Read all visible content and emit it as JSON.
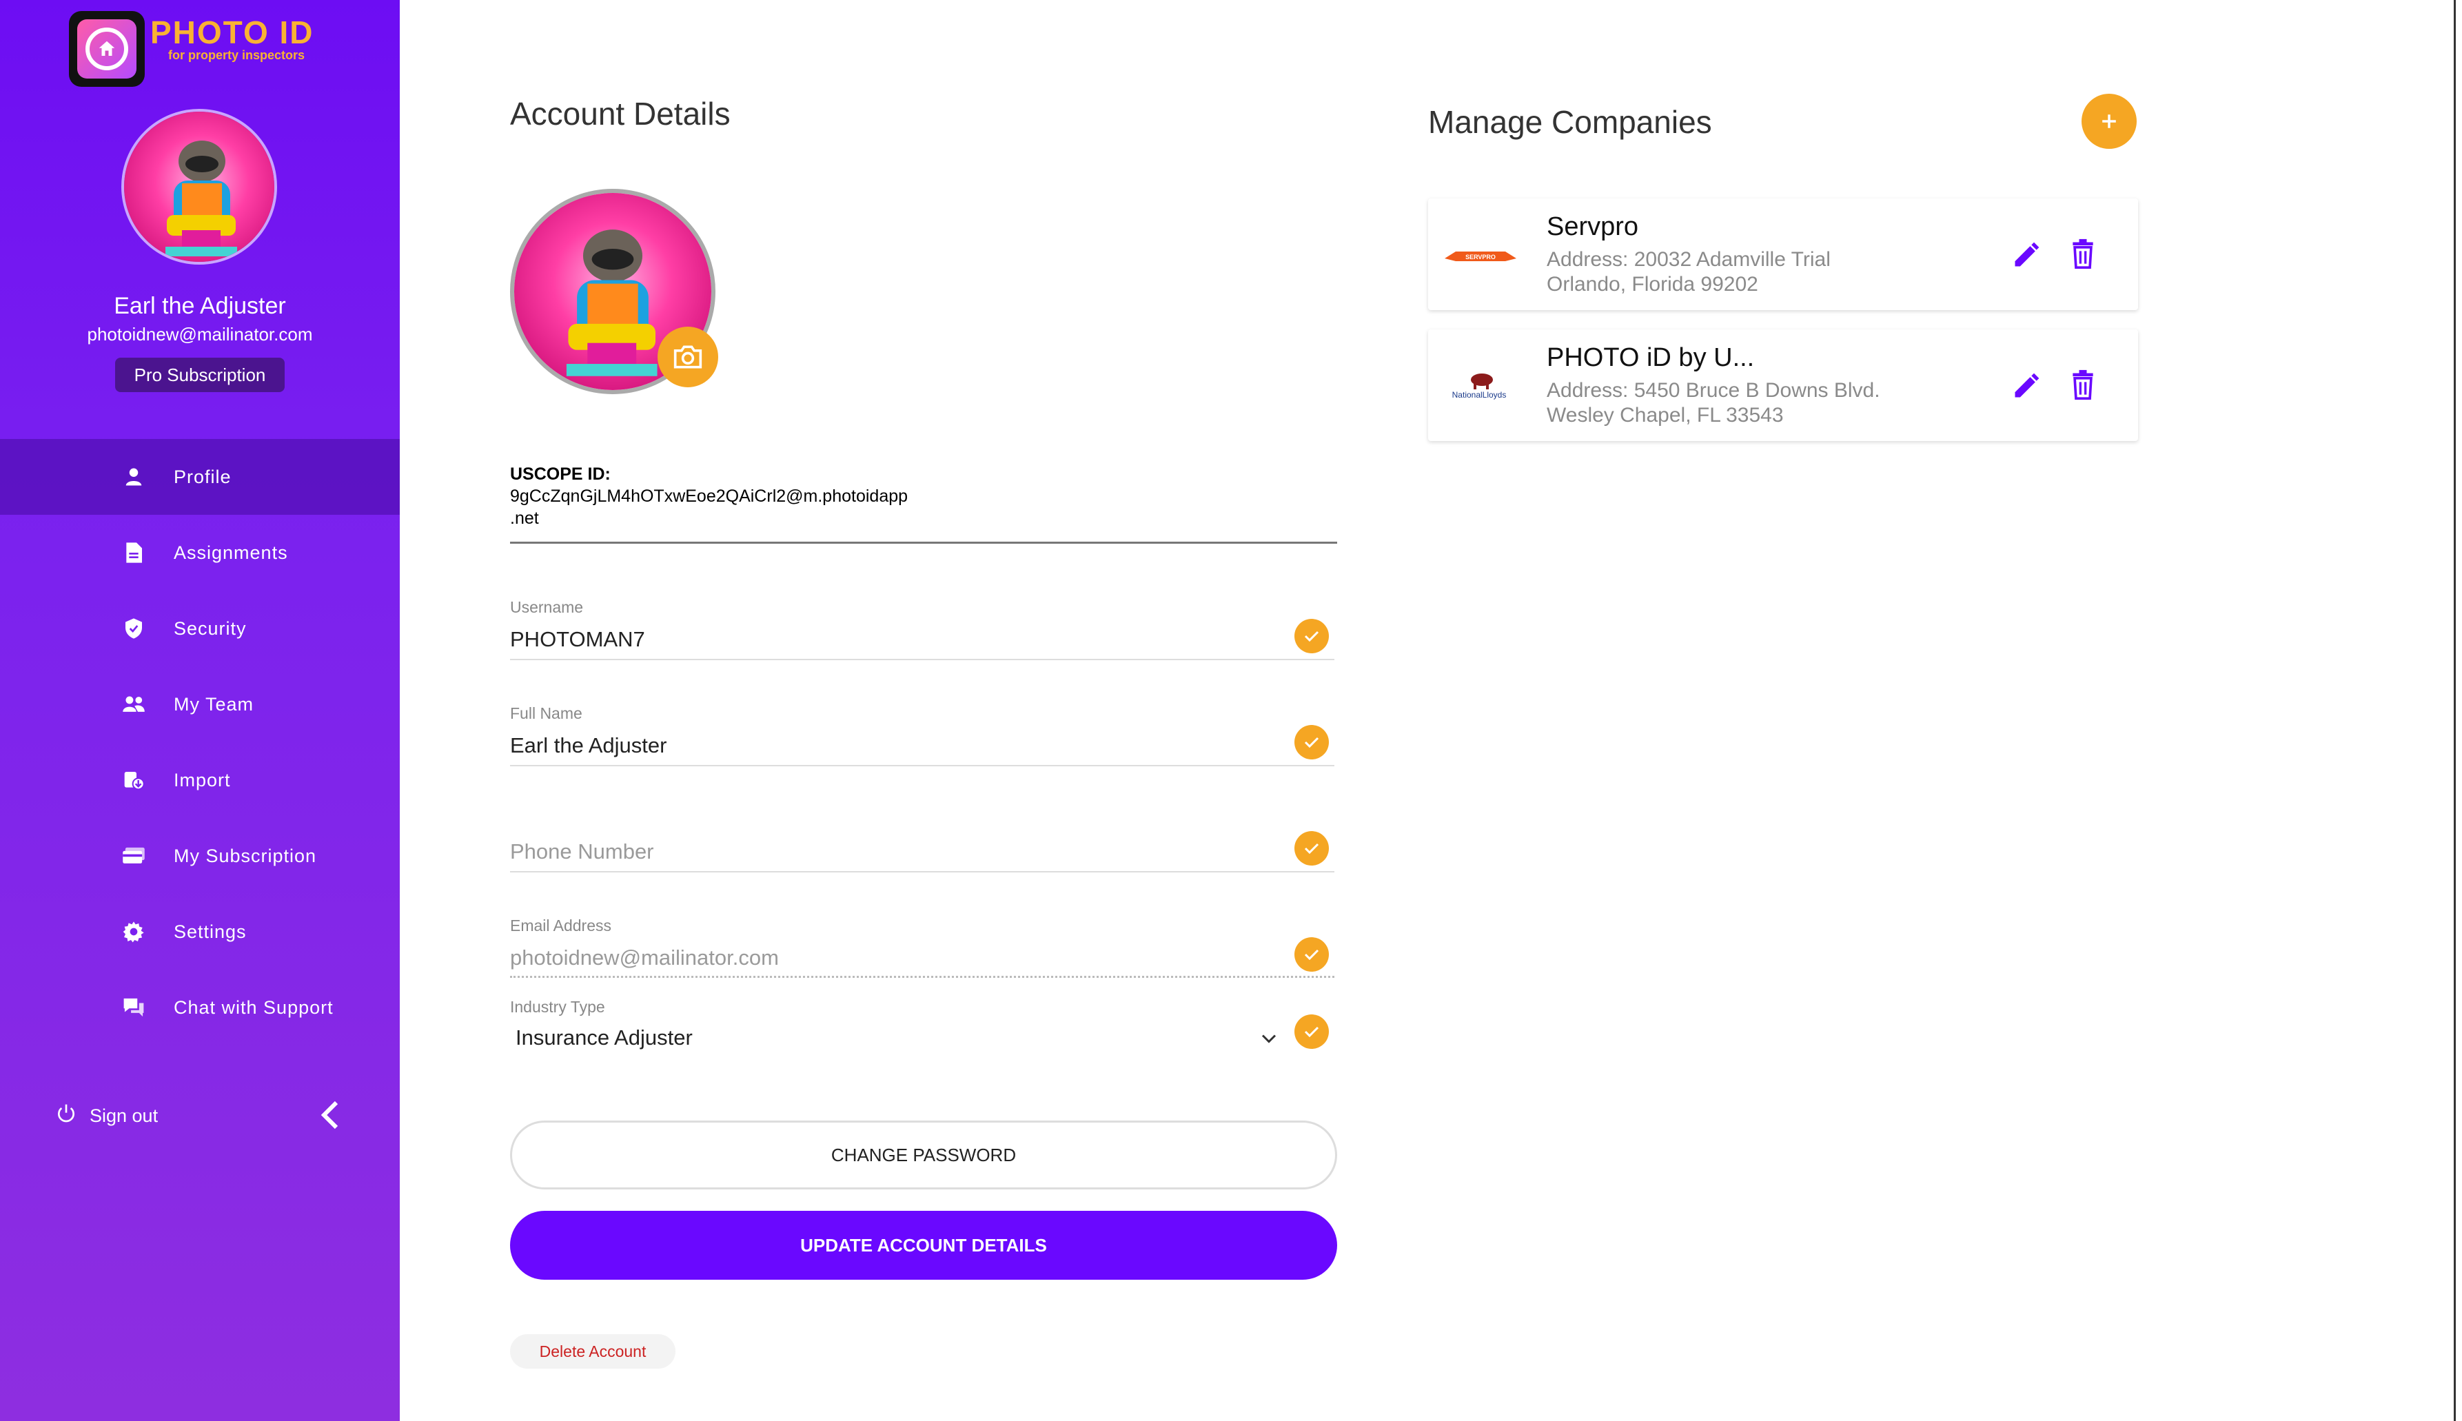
{
  "brand": {
    "name": "PHOTO ID",
    "tagline": "for property inspectors"
  },
  "user": {
    "name": "Earl the Adjuster",
    "email": "photoidnew@mailinator.com",
    "subscription": "Pro Subscription"
  },
  "nav": [
    {
      "label": "Profile",
      "icon": "person-icon",
      "active": true
    },
    {
      "label": "Assignments",
      "icon": "document-icon"
    },
    {
      "label": "Security",
      "icon": "shield-icon"
    },
    {
      "label": "My Team",
      "icon": "team-icon"
    },
    {
      "label": "Import",
      "icon": "import-icon"
    },
    {
      "label": "My Subscription",
      "icon": "card-icon"
    },
    {
      "label": "Settings",
      "icon": "gear-icon"
    },
    {
      "label": "Chat with Support",
      "icon": "chat-icon"
    }
  ],
  "signout": {
    "label": "Sign out"
  },
  "account": {
    "title": "Account Details",
    "uscope_label": "USCOPE ID:",
    "uscope_value": "9gCcZqnGjLM4hOTxwEoe2QAiCrl2@m.photoidapp\n.net",
    "username": {
      "label": "Username",
      "value": "PHOTOMAN7"
    },
    "fullname": {
      "label": "Full Name",
      "value": "Earl the Adjuster"
    },
    "phone": {
      "placeholder": "Phone Number"
    },
    "email": {
      "label": "Email Address",
      "value": "photoidnew@mailinator.com"
    },
    "industry": {
      "label": "Industry Type",
      "value": "Insurance Adjuster"
    },
    "change_password": "CHANGE PASSWORD",
    "update": "UPDATE ACCOUNT DETAILS",
    "delete": "Delete Account"
  },
  "companies": {
    "title": "Manage Companies",
    "items": [
      {
        "name": "Servpro",
        "address1": "Address: 20032 Adamville Trial",
        "address2": "Orlando, Florida 99202",
        "logo_text": "SERVPRO"
      },
      {
        "name": "PHOTO iD by U...",
        "address1": "Address: 5450 Bruce B Downs Blvd.",
        "address2": "Wesley Chapel, FL 33543",
        "logo_text": "NationalLloyds"
      }
    ]
  },
  "colors": {
    "accent": "#6a08ff",
    "orange": "#f5a623",
    "danger": "#cc2222"
  }
}
